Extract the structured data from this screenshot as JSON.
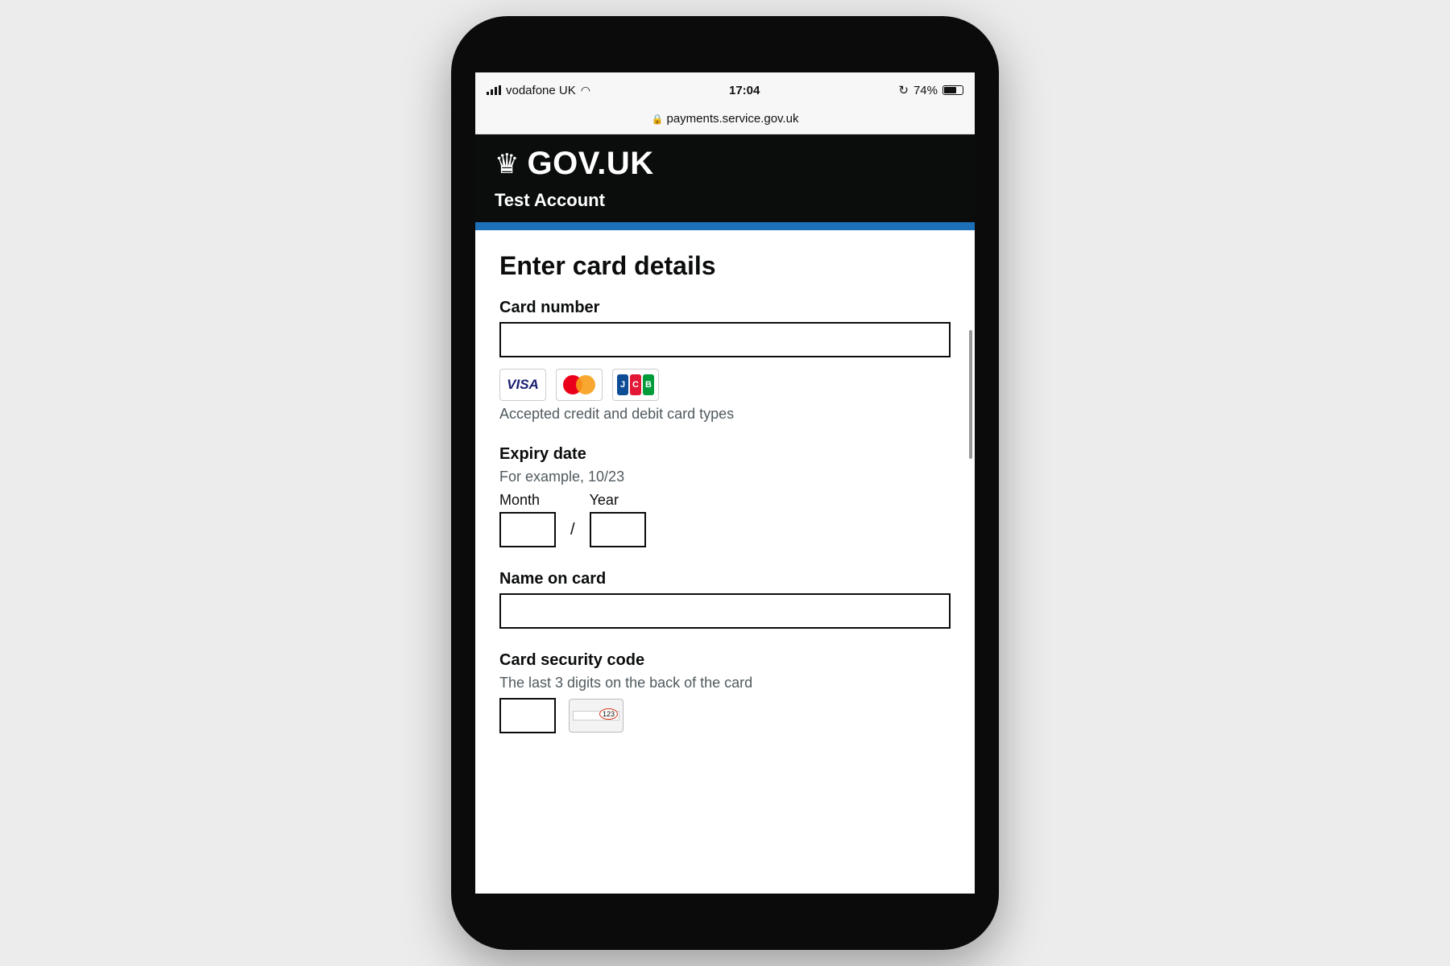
{
  "status_bar": {
    "carrier": "vodafone UK",
    "time": "17:04",
    "battery_percent": "74%",
    "battery_level": 0.74
  },
  "browser": {
    "url": "payments.service.gov.uk"
  },
  "header": {
    "logo_text": "GOV.UK",
    "service_name": "Test Account",
    "brand_color": "#1d70b8"
  },
  "form": {
    "title": "Enter card details",
    "card_number": {
      "label": "Card number",
      "value": "",
      "accepted_cards": [
        "VISA",
        "mastercard",
        "JCB"
      ],
      "accepted_hint": "Accepted credit and debit card types"
    },
    "expiry": {
      "label": "Expiry date",
      "hint": "For example, 10/23",
      "month_label": "Month",
      "year_label": "Year",
      "separator": "/",
      "month_value": "",
      "year_value": ""
    },
    "name_on_card": {
      "label": "Name on card",
      "value": ""
    },
    "security_code": {
      "label": "Card security code",
      "hint": "The last 3 digits on the back of the card",
      "image_digits": "123",
      "value": ""
    }
  }
}
